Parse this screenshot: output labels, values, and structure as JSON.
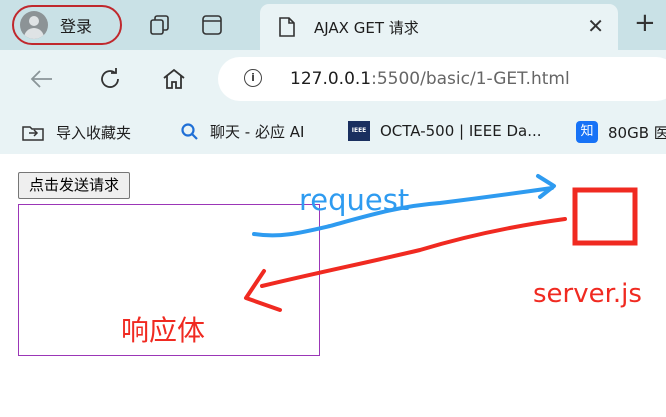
{
  "browser": {
    "profile_label": "登录",
    "tab_title": "AJAX GET 请求",
    "url_host": "127.0.0.1",
    "url_rest": ":5500/basic/1-GET.html",
    "bookmarks": [
      {
        "label": "导入收藏夹",
        "icon": "import-favorites-icon"
      },
      {
        "label": "聊天 - 必应 AI",
        "icon": "bing-search-icon"
      },
      {
        "label": "OCTA-500 | IEEE Da...",
        "icon": "ieee-icon",
        "icon_text": "IEEE"
      },
      {
        "label": "80GB 医",
        "icon": "zhihu-icon",
        "icon_text": "知"
      }
    ]
  },
  "page": {
    "send_button_label": "点击发送请求"
  },
  "annotations": {
    "request_label": "request",
    "response_label": "响应体",
    "server_label": "server.js",
    "request_color": "#2e9bf0",
    "response_color": "#f02a21"
  }
}
